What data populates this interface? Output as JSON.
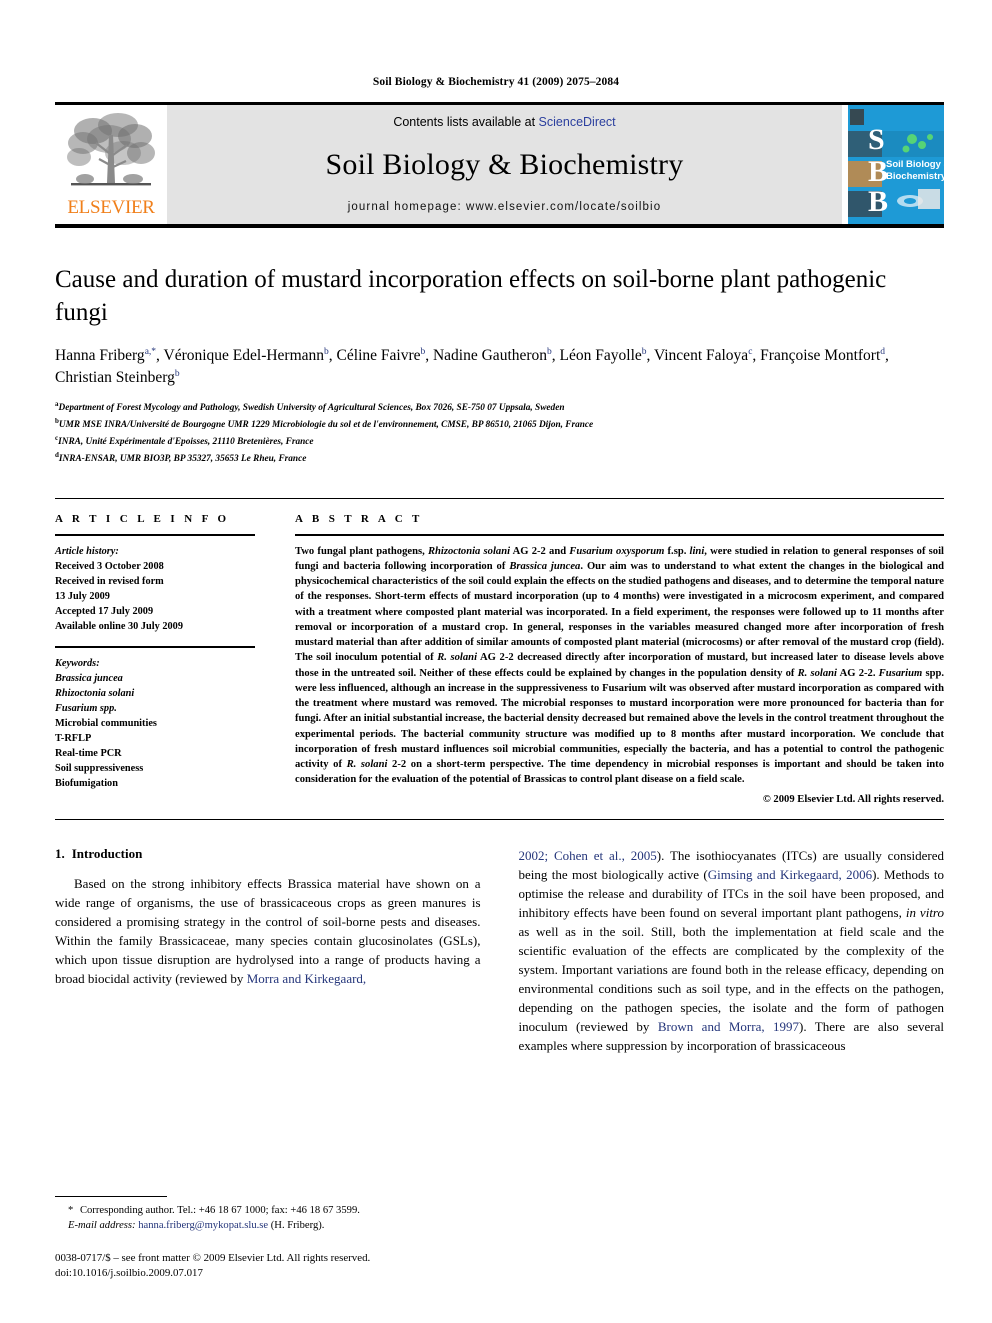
{
  "running_head": "Soil Biology & Biochemistry 41 (2009) 2075–2084",
  "masthead": {
    "contents_prefix": "Contents lists available at ",
    "sciencedirect": "ScienceDirect",
    "journal_title": "Soil Biology & Biochemistry",
    "homepage": "journal homepage: www.elsevier.com/locate/soilbio",
    "publisher": "ELSEVIER",
    "cover_letters": [
      "S",
      "B",
      "B"
    ],
    "cover_caption_line1": "Soil Biology &",
    "cover_caption_line2": "Biochemistry",
    "accent_orange": "#f07f1a",
    "link_blue": "#2b3f9e",
    "band_gray": "#e3e3e3",
    "cover_blue": "#1e9ad6"
  },
  "article": {
    "title": "Cause and duration of mustard incorporation effects on soil-borne plant pathogenic fungi",
    "authors_line1": "Hanna Friberg",
    "authors_html": "Hanna Friberg<sup>a,*</sup>, Véronique Edel-Hermann<sup>b</sup>, Céline Faivre<sup>b</sup>, Nadine Gautheron<sup>b</sup>, Léon Fayolle<sup>b</sup>, Vincent Faloya<sup>c</sup>, Françoise Montfort<sup>d</sup>, Christian Steinberg<sup>b</sup>",
    "affiliations": [
      {
        "label": "a",
        "text": "Department of Forest Mycology and Pathology, Swedish University of Agricultural Sciences, Box 7026, SE-750 07 Uppsala, Sweden"
      },
      {
        "label": "b",
        "text": "UMR MSE INRA/Université de Bourgogne UMR 1229 Microbiologie du sol et de l'environnement, CMSE, BP 86510, 21065 Dijon, France"
      },
      {
        "label": "c",
        "text": "INRA, Unité Expérimentale d'Epoisses, 21110 Bretenières, France"
      },
      {
        "label": "d",
        "text": "INRA-ENSAR, UMR BIO3P, BP 35327, 35653 Le Rheu, France"
      }
    ]
  },
  "article_info": {
    "heading": "A R T I C L E  I N F O",
    "history_label": "Article history:",
    "history": [
      "Received 3 October 2008",
      "Received in revised form",
      "13 July 2009",
      "Accepted 17 July 2009",
      "Available online 30 July 2009"
    ],
    "keywords_label": "Keywords:",
    "keywords": [
      {
        "text": "Brassica juncea",
        "italic": true
      },
      {
        "text": "Rhizoctonia solani",
        "italic": true
      },
      {
        "text": "Fusarium spp.",
        "italic": "partial"
      },
      {
        "text": "Microbial communities",
        "italic": false
      },
      {
        "text": "T-RFLP",
        "italic": false
      },
      {
        "text": "Real-time PCR",
        "italic": false
      },
      {
        "text": "Soil suppressiveness",
        "italic": false
      },
      {
        "text": "Biofumigation",
        "italic": false
      }
    ]
  },
  "abstract": {
    "heading": "A B S T R A C T",
    "text_html": "Two fungal plant pathogens, <i>Rhizoctonia solani</i> AG 2-2 and <i>Fusarium oxysporum</i> f.sp. <i>lini</i>, were studied in relation to general responses of soil fungi and bacteria following incorporation of <i>Brassica juncea</i>. Our aim was to understand to what extent the changes in the biological and physicochemical characteristics of the soil could explain the effects on the studied pathogens and diseases, and to determine the temporal nature of the responses. Short-term effects of mustard incorporation (up to 4 months) were investigated in a microcosm experiment, and compared with a treatment where composted plant material was incorporated. In a field experiment, the responses were followed up to 11 months after removal or incorporation of a mustard crop. In general, responses in the variables measured changed more after incorporation of fresh mustard material than after addition of similar amounts of composted plant material (microcosms) or after removal of the mustard crop (field). The soil inoculum potential of <i>R. solani</i> AG 2-2 decreased directly after incorporation of mustard, but increased later to disease levels above those in the untreated soil. Neither of these effects could be explained by changes in the population density of <i>R. solani</i> AG 2-2. <i>Fusarium</i> spp. were less influenced, although an increase in the suppressiveness to Fusarium wilt was observed after mustard incorporation as compared with the treatment where mustard was removed. The microbial responses to mustard incorporation were more pronounced for bacteria than for fungi. After an initial substantial increase, the bacterial density decreased but remained above the levels in the control treatment throughout the experimental periods. The bacterial community structure was modified up to 8 months after mustard incorporation. We conclude that incorporation of fresh mustard influences soil microbial communities, especially the bacteria, and has a potential to control the pathogenic activity of <i>R. solani</i> 2-2 on a short-term perspective. The time dependency in microbial responses is important and should be taken into consideration for the evaluation of the potential of Brassicas to control plant disease on a field scale.",
    "copyright": "© 2009 Elsevier Ltd. All rights reserved."
  },
  "intro": {
    "number": "1.",
    "heading": "Introduction",
    "left_para_html": "Based on the strong inhibitory effects Brassica material have shown on a wide range of organisms, the use of brassicaceous crops as green manures is considered a promising strategy in the control of soil-borne pests and diseases. Within the family Brassicaceae, many species contain glucosinolates (GSLs), which upon tissue disruption are hydrolysed into a range of products having a broad biocidal activity (reviewed by <span class=\"ref\">Morra and Kirkegaard,</span>",
    "right_para_html": "<span class=\"ref\">2002; Cohen et al., 2005</span>). The isothiocyanates (ITCs) are usually considered being the most biologically active (<span class=\"ref\">Gimsing and Kirkegaard, 2006</span>). Methods to optimise the release and durability of ITCs in the soil have been proposed, and inhibitory effects have been found on several important plant pathogens, <i>in vitro</i> as well as in the soil. Still, both the implementation at field scale and the scientific evaluation of the effects are complicated by the complexity of the system. Important variations are found both in the release efficacy, depending on environmental conditions such as soil type, and in the effects on the pathogen, depending on the pathogen species, the isolate and the form of pathogen inoculum (reviewed by <span class=\"ref\">Brown and Morra, 1997</span>). There are also several examples where suppression by incorporation of brassicaceous"
  },
  "footer": {
    "corresponding_html": "<span class=\"star\">*</span> Corresponding author. Tel.: +46 18 67 1000; fax: +46 18 67 3599.",
    "email_label": "E-mail address:",
    "email": "hanna.friberg@mykopat.slu.se",
    "email_suffix": "(H. Friberg).",
    "issn_line": "0038-0717/$ – see front matter © 2009 Elsevier Ltd. All rights reserved.",
    "doi_line": "doi:10.1016/j.soilbio.2009.07.017"
  }
}
